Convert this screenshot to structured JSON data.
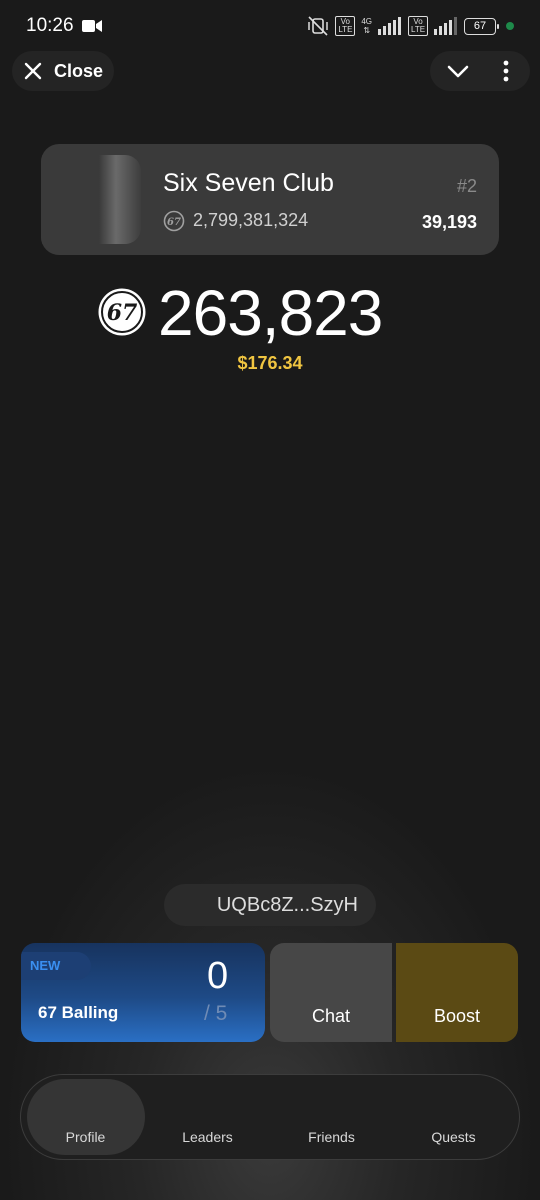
{
  "status_bar": {
    "time": "10:26",
    "network": "4G",
    "battery": "67"
  },
  "top": {
    "close_label": "Close"
  },
  "club": {
    "name": "Six Seven Club",
    "rank": "#2",
    "total": "2,799,381,324",
    "members": "39,193"
  },
  "balance": {
    "amount": "263,823",
    "usd": "$176.34"
  },
  "wallet": {
    "address": "UQBc8Z...SzyH"
  },
  "cards": {
    "balling": {
      "badge": "NEW",
      "label": "67 Balling",
      "count": "0",
      "total": "/ 5"
    },
    "chat_label": "Chat",
    "boost_label": "Boost"
  },
  "nav": {
    "items": [
      {
        "label": "Profile"
      },
      {
        "label": "Leaders"
      },
      {
        "label": "Friends"
      },
      {
        "label": "Quests"
      }
    ],
    "active": "Profile"
  },
  "colors": {
    "accent_gold": "#f0c541",
    "balling_blue": "#2a6fc4",
    "boost_bg": "#5b4a14"
  }
}
